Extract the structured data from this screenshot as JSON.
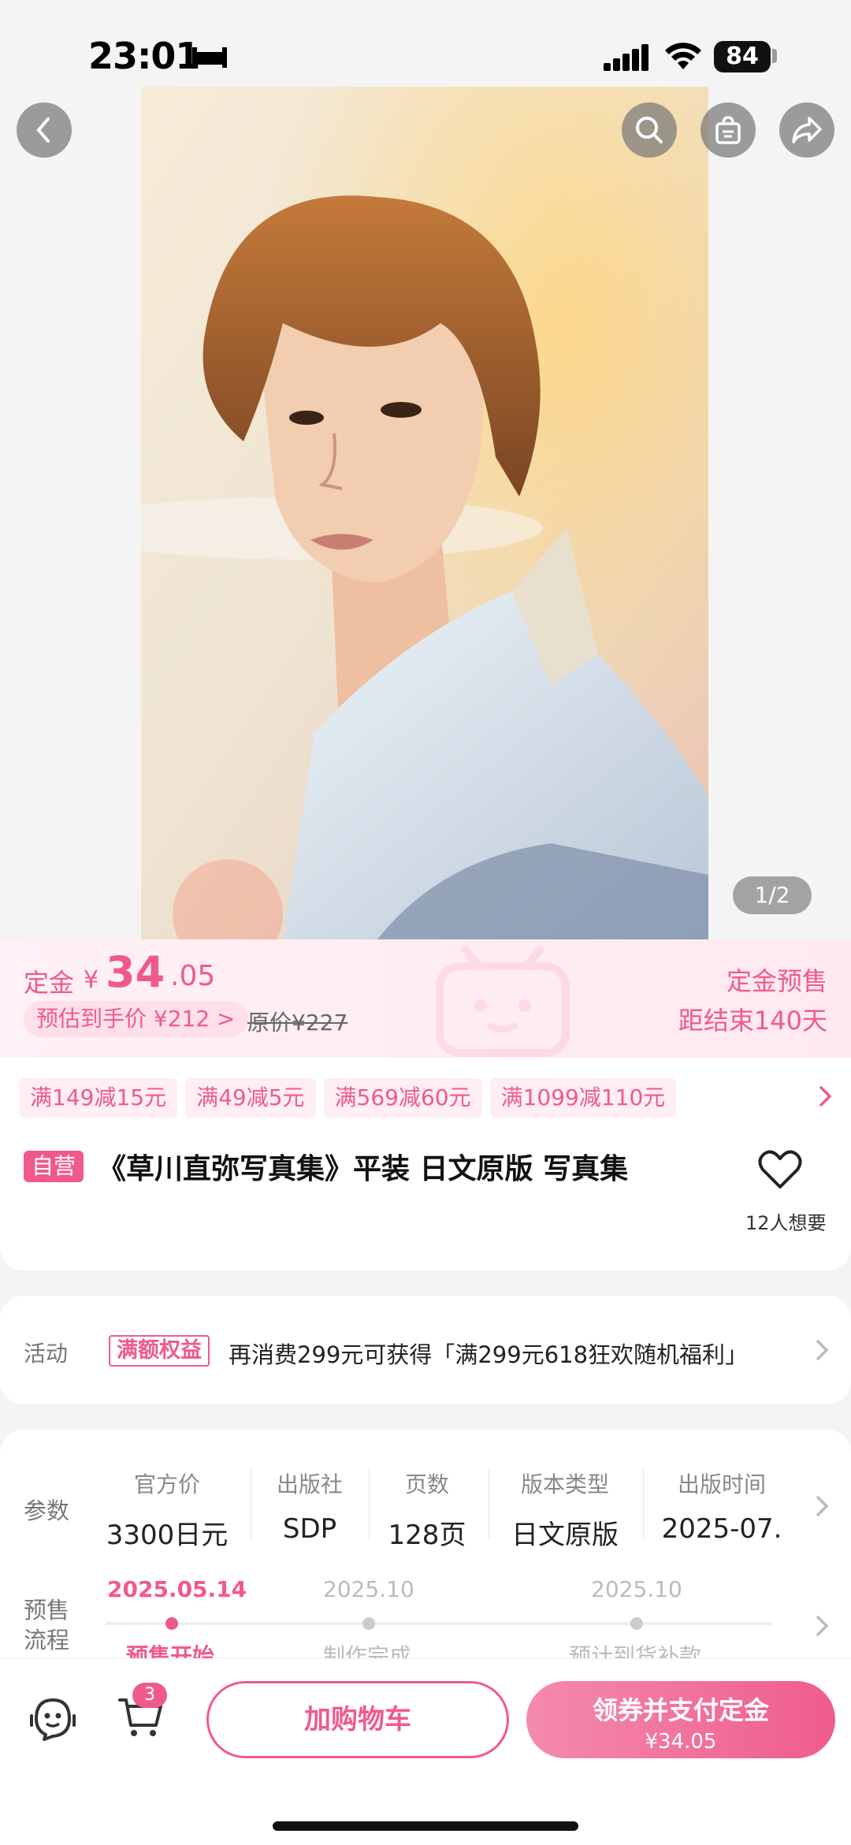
{
  "status_bar": {
    "time": "23:01",
    "battery": "84"
  },
  "gallery": {
    "pager": "1/2"
  },
  "price": {
    "deposit_label": "定金",
    "currency": "¥",
    "amount_int": "34",
    "amount_dec": ".05",
    "estimate": "预估到手价 ¥212 >",
    "original": "原价¥227",
    "sale_type": "定金预售",
    "countdown": "距结束140天"
  },
  "coupons": [
    "满149减15元",
    "满49减5元",
    "满569减60元",
    "满1099减110元"
  ],
  "product": {
    "tag": "自营",
    "title": "《草川直弥写真集》平装 日文原版 写真集",
    "want_count": "12人想要"
  },
  "activity": {
    "label": "活动",
    "tag": "满额权益",
    "text": "再消费299元可获得「满299元618狂欢随机福利」"
  },
  "params": {
    "label": "参数",
    "items": [
      {
        "key": "官方价",
        "value": "3300日元"
      },
      {
        "key": "出版社",
        "value": "SDP"
      },
      {
        "key": "页数",
        "value": "128页"
      },
      {
        "key": "版本类型",
        "value": "日文原版"
      },
      {
        "key": "出版时间",
        "value": "2025-07."
      }
    ]
  },
  "presale_flow": {
    "label_line1": "预售",
    "label_line2": "流程",
    "steps": [
      {
        "date": "2025.05.14",
        "name": "预售开始",
        "active": true
      },
      {
        "date": "2025.10",
        "name": "制作完成",
        "active": false
      },
      {
        "date": "2025.10",
        "name": "预计到货补款",
        "active": false
      }
    ]
  },
  "bottom_bar": {
    "cart_count": "3",
    "add_to_cart": "加购物车",
    "pay_line1": "领券并支付定金",
    "pay_line2": "¥34.05"
  },
  "colors": {
    "accent": "#f05a8a",
    "accent_light": "#ffeef3"
  },
  "icons": [
    "back-icon",
    "search-icon",
    "shopping-bag-icon",
    "share-icon",
    "heart-icon",
    "customer-service-icon",
    "cart-icon",
    "chevron-right-icon"
  ]
}
